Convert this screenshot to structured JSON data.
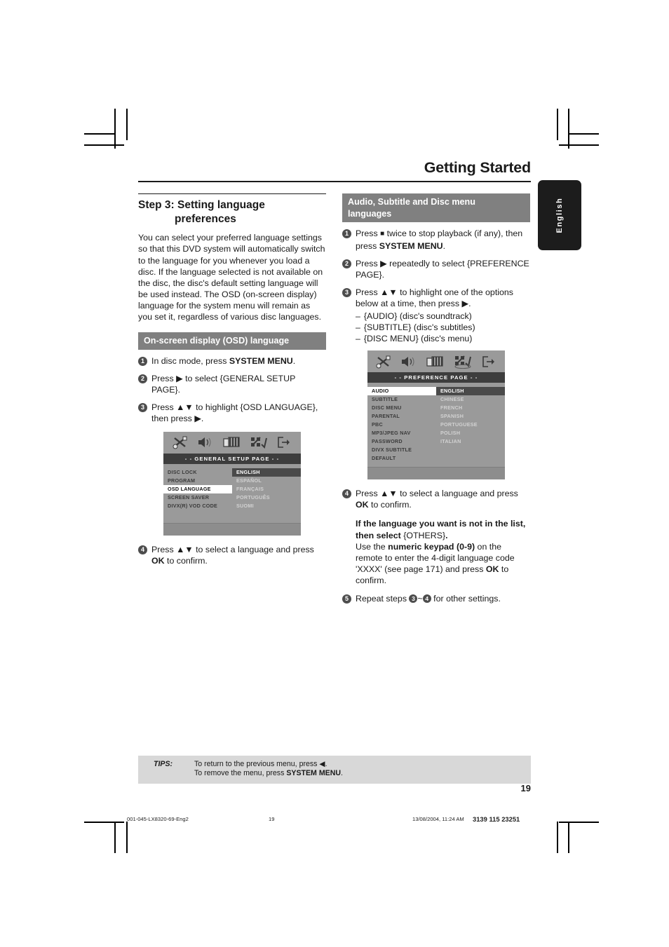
{
  "header": {
    "title": "Getting Started",
    "side_tab": "English"
  },
  "left_column": {
    "step_heading_line1": "Step 3: Setting language",
    "step_heading_line2": "preferences",
    "intro": "You can select your preferred language settings so that this DVD system will automatically switch to the language for you whenever you load a disc.  If the language selected is not available on the disc, the disc's default setting language will be used instead.  The OSD (on-screen display) language for the system menu will remain as you set it, regardless of various disc languages.",
    "section_heading": "On-screen display (OSD) language",
    "steps": [
      {
        "num": "1",
        "text_before": "In disc mode, press ",
        "bold": "SYSTEM MENU",
        "text_after": "."
      },
      {
        "num": "2",
        "text_before": "Press ",
        "arrow": "▶",
        "text_after": " to select {GENERAL SETUP PAGE}."
      },
      {
        "num": "3",
        "text_before": "Press ",
        "arrow": "▲▼",
        "text_after": " to highlight {OSD LANGUAGE}, then press ",
        "arrow2": "▶",
        "tail": "."
      }
    ],
    "step4": {
      "num": "4",
      "text_before": "Press ",
      "arrow": "▲▼",
      "text_mid": " to select a language and press ",
      "bold": "OK",
      "text_after": " to confirm."
    },
    "osd_figure": {
      "title": "- -  GENERAL  SETUP  PAGE  - -",
      "menu_items": [
        "DISC LOCK",
        "PROGRAM",
        "OSD LANGUAGE",
        "SCREEN SAVER",
        "DIVX(R) VOD CODE"
      ],
      "selected_item": "OSD LANGUAGE",
      "options": [
        "ENGLISH",
        "ESPAÑOL",
        "FRANÇAIS",
        "PORTUGUÊS",
        "SUOMI"
      ],
      "selected_option": "ENGLISH",
      "icons": [
        "tools-icon",
        "speaker-icon",
        "video-icon",
        "preference-icon",
        "exit-icon"
      ]
    }
  },
  "right_column": {
    "section_heading_line1": "Audio, Subtitle and Disc menu",
    "section_heading_line2": "languages",
    "steps": [
      {
        "num": "1",
        "text_before": "Press ",
        "glyph": "■",
        "text_mid": " twice to stop playback (if any), then press ",
        "bold": "SYSTEM MENU",
        "text_after": "."
      },
      {
        "num": "2",
        "text_before": "Press ",
        "arrow": "▶",
        "text_after": " repeatedly to select {PREFERENCE PAGE}."
      },
      {
        "num": "3",
        "text_before": "Press ",
        "arrow": "▲▼",
        "text_mid": " to highlight one of the options below at a time, then press ",
        "arrow2": "▶",
        "text_after": ".",
        "sub_items": [
          "{AUDIO} (disc's soundtrack)",
          "{SUBTITLE} (disc's subtitles)",
          "{DISC MENU} (disc's menu)"
        ]
      }
    ],
    "step4": {
      "num": "4",
      "text_before": "Press ",
      "arrow": "▲▼",
      "text_mid": " to select a language and press ",
      "bold": "OK",
      "text_after": " to confirm."
    },
    "note": {
      "bold1": "If the language you want is not in the list, then select ",
      "plain1": "{OTHERS}",
      "bold_period": ".",
      "plain2": "Use the ",
      "bold2": "numeric keypad (0-9)",
      "plain3": " on the remote to enter the 4-digit language code 'XXXX' (see page 171) and press ",
      "bold3": "OK",
      "plain4": " to confirm."
    },
    "step5": {
      "num": "5",
      "text_before": "Repeat steps ",
      "ref1": "3",
      "tilde": "~",
      "ref2": "4",
      "text_after": " for other settings."
    },
    "osd_figure": {
      "title": "- -  PREFERENCE  PAGE  - -",
      "menu_items": [
        "AUDIO",
        "SUBTITLE",
        "DISC MENU",
        "PARENTAL",
        "PBC",
        "MP3/JPEG NAV",
        "PASSWORD",
        "DIVX SUBTITLE",
        "DEFAULT"
      ],
      "selected_item": "AUDIO",
      "options": [
        "ENGLISH",
        "CHINESE",
        "FRENCH",
        "SPANISH",
        "PORTUGUESE",
        "POLISH",
        "ITALIAN"
      ],
      "selected_option": "ENGLISH",
      "icons": [
        "tools-icon",
        "speaker-icon",
        "video-icon",
        "preference-icon",
        "exit-icon"
      ]
    }
  },
  "tips": {
    "label": "TIPS:",
    "line1_before": "To return to the previous menu, press ",
    "line1_arrow": "◀",
    "line1_after": ".",
    "line2_before": "To remove the menu, press ",
    "line2_bold": "SYSTEM MENU",
    "line2_after": "."
  },
  "page_number": "19",
  "printer_footer": {
    "file": "001-045-LX8320-69-Eng2",
    "page": "19",
    "date": "13/08/2004, 11:24 AM",
    "code": "3139 115 23251"
  },
  "colors": {
    "bar_grey": "#808080",
    "tips_grey": "#d8d8d8",
    "osd_grey": "#9a9a9a",
    "osd_title": "#3d3d3d",
    "tab_black": "#1c1c1c"
  }
}
